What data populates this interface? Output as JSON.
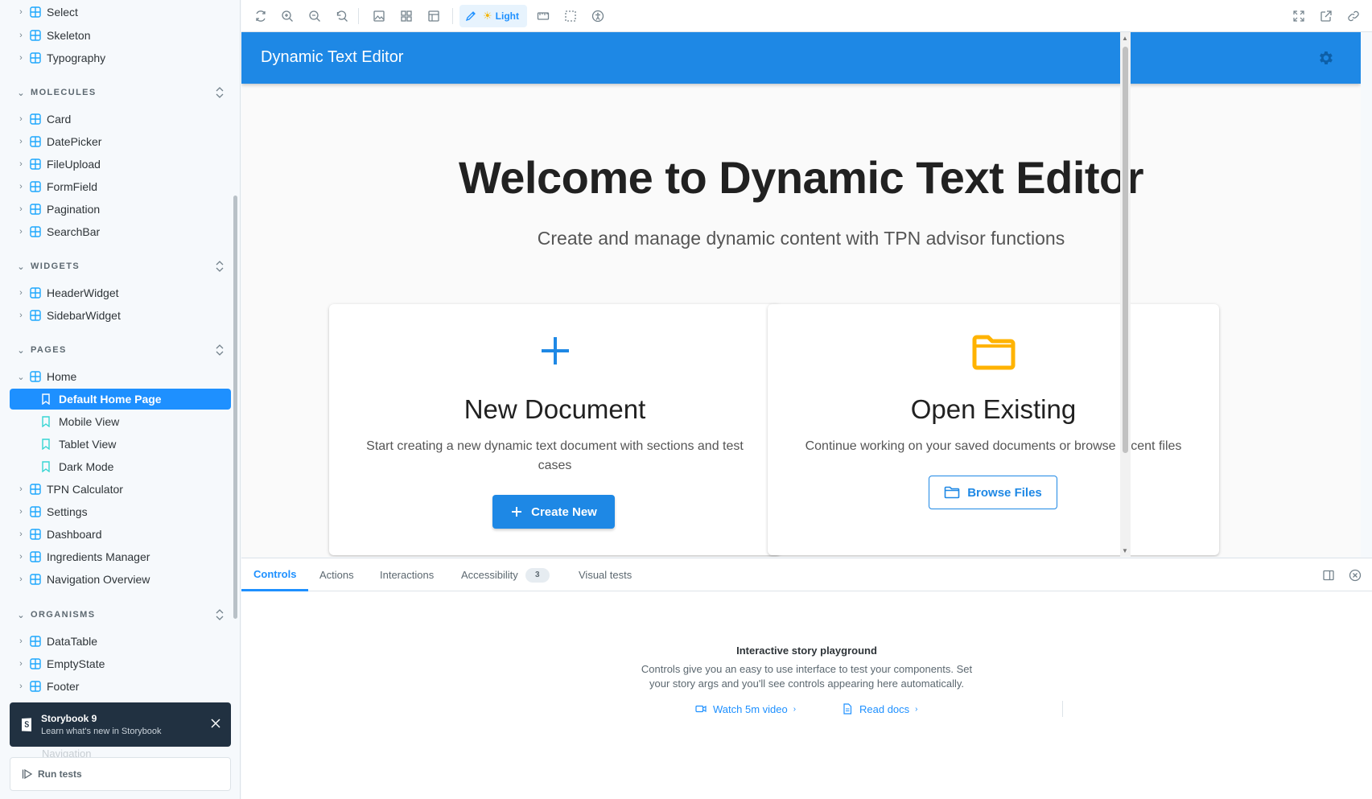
{
  "sidebar": {
    "rows": [
      {
        "label": "Select",
        "kind": "component",
        "expanded": false
      },
      {
        "label": "Skeleton",
        "kind": "component",
        "expanded": false
      },
      {
        "label": "Typography",
        "kind": "component",
        "expanded": false
      }
    ],
    "sections": [
      {
        "title": "MOLECULES",
        "items": [
          "Card",
          "DatePicker",
          "FileUpload",
          "FormField",
          "Pagination",
          "SearchBar"
        ]
      },
      {
        "title": "WIDGETS",
        "items": [
          "HeaderWidget",
          "SidebarWidget"
        ]
      },
      {
        "title": "PAGES",
        "items": [
          "Home"
        ]
      },
      {
        "title": "ORGANISMS",
        "items": [
          "DataTable",
          "EmptyState",
          "Footer"
        ]
      }
    ],
    "home_stories": [
      "Default Home Page",
      "Mobile View",
      "Tablet View",
      "Dark Mode"
    ],
    "selected_story": "Default Home Page",
    "pages_after_home": [
      "TPN Calculator",
      "Settings",
      "Dashboard",
      "Ingredients Manager",
      "Navigation Overview"
    ],
    "toast": {
      "title": "Storybook 9",
      "subtitle": "Learn what's new in Storybook"
    },
    "ghost_item": "Navigation",
    "run_tests": "Run tests"
  },
  "toolbar": {
    "theme_label": "Light",
    "icons": [
      "reload-icon",
      "zoom-in-icon",
      "zoom-out-icon",
      "zoom-reset-icon",
      "background-icon",
      "grid-icon",
      "viewport-icon",
      "measure-icon",
      "outline-icon",
      "accessibility-icon",
      "fullscreen-icon",
      "open-new-tab-icon",
      "copy-link-icon"
    ]
  },
  "preview": {
    "app_title": "Dynamic Text Editor",
    "welcome": "Welcome to Dynamic Text Editor",
    "subtitle": "Create and manage dynamic content with TPN advisor functions",
    "cards": {
      "new": {
        "title": "New Document",
        "description": "Start creating a new dynamic text document with sections and test cases",
        "button": "Create New"
      },
      "open": {
        "title": "Open Existing",
        "description": "Continue working on your saved documents or browse recent files",
        "button": "Browse Files"
      }
    },
    "colors": {
      "primary": "#1e88e5",
      "folder": "#ffb300"
    }
  },
  "addons": {
    "tabs": [
      {
        "label": "Controls",
        "active": true
      },
      {
        "label": "Actions",
        "active": false
      },
      {
        "label": "Interactions",
        "active": false
      },
      {
        "label": "Accessibility",
        "active": false,
        "badge": "3"
      },
      {
        "label": "Visual tests",
        "active": false
      }
    ],
    "playground": {
      "title": "Interactive story playground",
      "description": "Controls give you an easy to use interface to test your components. Set your story args and you'll see controls appearing here automatically.",
      "video_link": "Watch 5m video",
      "docs_link": "Read docs"
    }
  }
}
